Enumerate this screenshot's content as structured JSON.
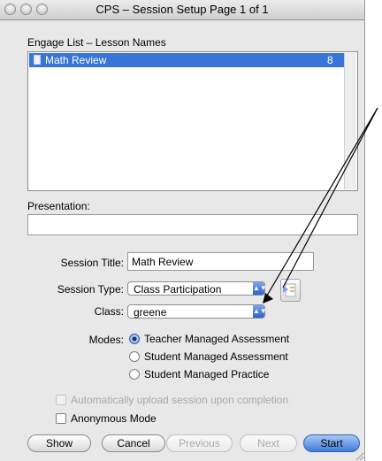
{
  "window": {
    "title": "CPS – Session Setup Page 1 of 1"
  },
  "engage_list": {
    "label": "Engage List – Lesson Names",
    "items": [
      {
        "name": "Math Review",
        "count": "8",
        "selected": true
      }
    ]
  },
  "presentation": {
    "label": "Presentation:",
    "value": ""
  },
  "session_title": {
    "label": "Session Title:",
    "value": "Math Review"
  },
  "session_type": {
    "label": "Session Type:",
    "value": "Class Participation"
  },
  "class": {
    "label": "Class:",
    "value": "greene"
  },
  "modes": {
    "label": "Modes:",
    "options": [
      {
        "label": "Teacher Managed Assessment",
        "selected": true
      },
      {
        "label": "Student Managed Assessment",
        "selected": false
      },
      {
        "label": "Student Managed Practice",
        "selected": false
      }
    ]
  },
  "options": {
    "auto_upload": {
      "label": "Automatically upload session upon completion",
      "checked": false,
      "enabled": false
    },
    "anonymous": {
      "label": "Anonymous Mode",
      "checked": false,
      "enabled": true
    }
  },
  "buttons": {
    "show": "Show",
    "cancel": "Cancel",
    "previous": "Previous",
    "next": "Next",
    "start": "Start"
  },
  "icons": {
    "session_type_icon": "document-slide-icon",
    "annotation": "arrow-annotation"
  },
  "colors": {
    "selection": "#3875d7",
    "default_button": "#3f7cdb"
  }
}
